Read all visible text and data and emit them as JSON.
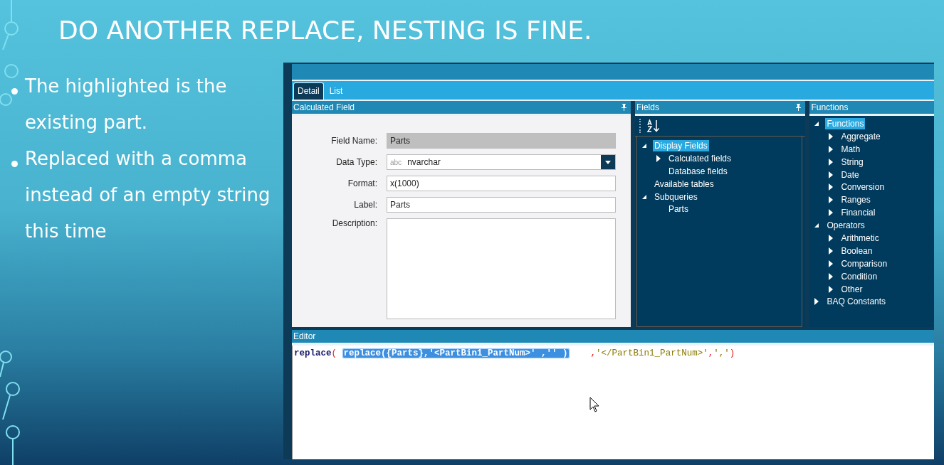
{
  "title": "DO ANOTHER REPLACE, NESTING IS FINE.",
  "bullets": [
    "The highlighted is the existing part.",
    "Replaced with a comma instead of an empty string this time"
  ],
  "tabs": [
    {
      "label": "Detail",
      "selected": true
    },
    {
      "label": "List",
      "selected": false
    }
  ],
  "calculated_field": {
    "title": "Calculated Field",
    "fields": [
      {
        "kind": "readonly",
        "label": "Field Name:",
        "value": "Parts"
      },
      {
        "kind": "dropdown",
        "label": "Data Type:",
        "type_hint": "abc",
        "value": "nvarchar"
      },
      {
        "kind": "text",
        "label": "Format:",
        "value": "x(1000)"
      },
      {
        "kind": "text",
        "label": "Label:",
        "value": "Parts"
      },
      {
        "kind": "textarea",
        "label": "Description:"
      }
    ]
  },
  "fields_panel": {
    "title": "Fields",
    "tree": [
      {
        "label": "Display Fields",
        "expanded": true,
        "selected": true,
        "children": [
          {
            "label": "Calculated fields",
            "expanded": false,
            "selected": false
          },
          {
            "label": "Database fields",
            "selected": false
          }
        ]
      },
      {
        "label": "Available tables",
        "selected": false
      },
      {
        "label": "Subqueries",
        "expanded": true,
        "selected": false,
        "children": [
          {
            "label": "Parts",
            "selected": false
          }
        ]
      }
    ]
  },
  "functions_panel": {
    "title": "Functions",
    "tree": [
      {
        "label": "Functions",
        "expanded": true,
        "selected": true,
        "children": [
          {
            "label": "Aggregate",
            "expanded": false,
            "selected": false
          },
          {
            "label": "Math",
            "expanded": false,
            "selected": false
          },
          {
            "label": "String",
            "expanded": false,
            "selected": false
          },
          {
            "label": "Date",
            "expanded": false,
            "selected": false
          },
          {
            "label": "Conversion",
            "expanded": false,
            "selected": false
          },
          {
            "label": "Ranges",
            "expanded": false,
            "selected": false
          },
          {
            "label": "Financial",
            "expanded": false,
            "selected": false
          }
        ]
      },
      {
        "label": "Operators",
        "expanded": true,
        "selected": false,
        "children": [
          {
            "label": "Arithmetic",
            "expanded": false,
            "selected": false
          },
          {
            "label": "Boolean",
            "expanded": false,
            "selected": false
          },
          {
            "label": "Comparison",
            "expanded": false,
            "selected": false
          },
          {
            "label": "Condition",
            "expanded": false,
            "selected": false
          },
          {
            "label": "Other",
            "expanded": false,
            "selected": false
          }
        ]
      },
      {
        "label": "BAQ Constants",
        "expanded": false,
        "selected": false
      }
    ]
  },
  "editor": {
    "title": "Editor",
    "code": [
      {
        "kind": "keyword",
        "text": "replace"
      },
      {
        "kind": "punct",
        "text": "( "
      },
      {
        "kind": "highlight",
        "text": "replace({Parts},'<PartBin1_PartNum>' ,'' )"
      },
      {
        "kind": "punct",
        "text": "    ,"
      },
      {
        "kind": "string",
        "text": "'</PartBin1_PartNum>'"
      },
      {
        "kind": "punct",
        "text": ","
      },
      {
        "kind": "string",
        "text": "','"
      },
      {
        "kind": "punct",
        "text": ")"
      }
    ]
  }
}
